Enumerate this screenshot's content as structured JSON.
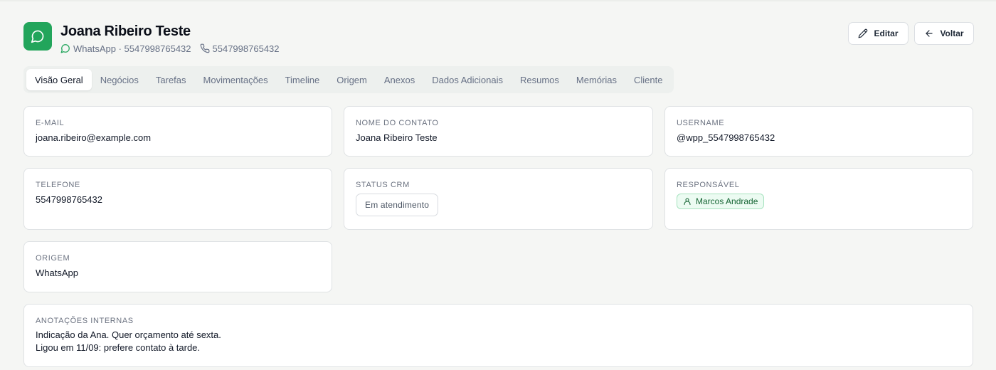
{
  "header": {
    "title": "Joana Ribeiro Teste",
    "channel": "WhatsApp · 5547998765432",
    "phone": "5547998765432",
    "avatar_icon": "whatsapp-chat-icon",
    "accent_color": "#22a55b"
  },
  "actions": {
    "edit_label": "Editar",
    "edit_icon": "pencil-icon",
    "back_label": "Voltar",
    "back_icon": "arrow-left-icon"
  },
  "tabs": [
    {
      "label": "Visão Geral",
      "active": true
    },
    {
      "label": "Negócios",
      "active": false
    },
    {
      "label": "Tarefas",
      "active": false
    },
    {
      "label": "Movimentações",
      "active": false
    },
    {
      "label": "Timeline",
      "active": false
    },
    {
      "label": "Origem",
      "active": false
    },
    {
      "label": "Anexos",
      "active": false
    },
    {
      "label": "Dados Adicionais",
      "active": false
    },
    {
      "label": "Resumos",
      "active": false
    },
    {
      "label": "Memórias",
      "active": false
    },
    {
      "label": "Cliente",
      "active": false
    }
  ],
  "fields": {
    "email": {
      "label": "E-MAIL",
      "value": "joana.ribeiro@example.com"
    },
    "contact_name": {
      "label": "NOME DO CONTATO",
      "value": "Joana Ribeiro Teste"
    },
    "username": {
      "label": "USERNAME",
      "value": "@wpp_5547998765432"
    },
    "phone": {
      "label": "TELEFONE",
      "value": "5547998765432"
    },
    "crm_status": {
      "label": "STATUS CRM",
      "value": "Em atendimento"
    },
    "owner": {
      "label": "RESPONSÁVEL",
      "value": "Marcos Andrade",
      "icon": "user-icon",
      "color": "#166534"
    },
    "origin": {
      "label": "ORIGEM",
      "value": "WhatsApp"
    },
    "notes": {
      "label": "ANOTAÇÕES INTERNAS",
      "line1": "Indicação da Ana. Quer orçamento até sexta.",
      "line2": "Ligou em 11/09: prefere contato à tarde."
    }
  }
}
